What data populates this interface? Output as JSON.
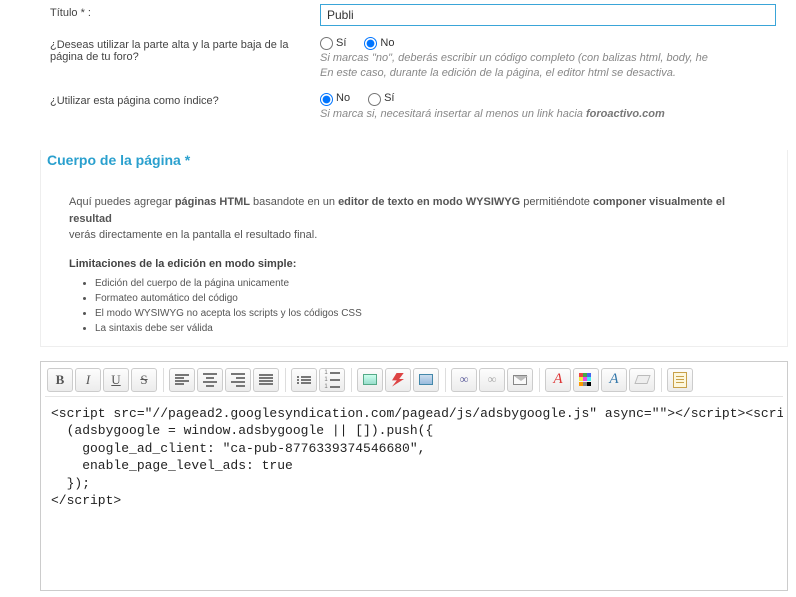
{
  "form": {
    "title_label": "Título * :",
    "title_value": "Publi",
    "use_top_bottom_label": "¿Deseas utilizar la parte alta y la parte baja de la página de tu foro?",
    "use_as_index_label": "¿Utilizar esta página como índice?",
    "radio": {
      "yes": "Sí",
      "no": "No"
    },
    "help1_line1": "Si marcas \"no\", deberás escribir un código completo (con balizas html, body, he",
    "help1_line2": "En este caso, durante la edición de la página, el editor html se desactiva.",
    "help2_prefix": "Si marca si, necesitará insertar al menos un link hacia ",
    "help2_bold": "foroactivo.com"
  },
  "panel": {
    "title": "Cuerpo de la página *",
    "intro_parts": {
      "t1": "Aquí puedes agregar ",
      "b1": "páginas HTML",
      "t2": " basandote en un ",
      "b2": "editor de texto en modo WYSIWYG",
      "t3": " permitiéndote ",
      "b3": "componer visualmente el resultad",
      "t4": "verás directamente en la pantalla el resultado final."
    },
    "limitations_title": "Limitaciones de la edición en modo simple:",
    "limitations": [
      "Edición del cuerpo de la página unicamente",
      "Formateo automático del código",
      "El modo WYSIWYG no acepta los scripts y los códigos CSS",
      "La sintaxis debe ser válida"
    ]
  },
  "toolbar": {
    "bold": "B",
    "italic": "I",
    "underline": "U",
    "strike": "S",
    "fontletter_a": "A",
    "fontletter_a2": "A"
  },
  "code": "<script src=\"//pagead2.googlesyndication.com/pagead/js/adsbygoogle.js\" async=\"\"></script><script>\n  (adsbygoogle = window.adsbygoogle || []).push({\n    google_ad_client: \"ca-pub-8776339374546680\",\n    enable_page_level_ads: true\n  });\n</script>"
}
